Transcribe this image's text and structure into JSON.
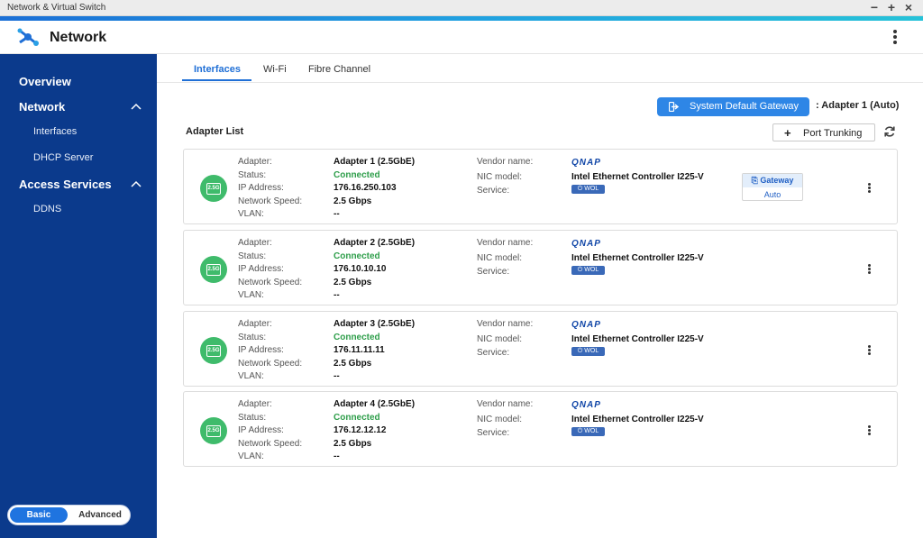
{
  "window": {
    "title": "Network & Virtual Switch",
    "controls": [
      "−",
      "+",
      "×"
    ]
  },
  "header": {
    "app_title": "Network"
  },
  "sidebar": {
    "items": [
      {
        "label": "Overview"
      },
      {
        "label": "Network"
      },
      {
        "label": "Interfaces"
      },
      {
        "label": "DHCP Server"
      },
      {
        "label": "Access Services"
      },
      {
        "label": "DDNS"
      }
    ],
    "mode": {
      "basic": "Basic",
      "advanced": "Advanced",
      "selected": "Basic"
    }
  },
  "tabs": [
    {
      "label": "Interfaces"
    },
    {
      "label": "Wi-Fi"
    },
    {
      "label": "Fibre Channel"
    }
  ],
  "gateway": {
    "button_label": "System Default Gateway",
    "value": ": Adapter 1 (Auto)"
  },
  "adapter_list": {
    "title": "Adapter List",
    "port_trunking_label": "Port Trunking",
    "field_labels": {
      "adapter": "Adapter:",
      "status": "Status:",
      "ip": "IP Address:",
      "speed": "Network Speed:",
      "vlan": "VLAN:",
      "vendor": "Vendor name:",
      "nic": "NIC model:",
      "service": "Service:"
    },
    "adapters": [
      {
        "icon_text": "2.5G",
        "name": "Adapter 1 (2.5GbE)",
        "status": "Connected",
        "ip": "176.16.250.103",
        "speed": "2.5 Gbps",
        "vlan": "--",
        "vendor": "QNAP",
        "nic": "Intel Ethernet Controller I225-V",
        "service": "WOL",
        "gateway": {
          "label": "Gateway",
          "mode": "Auto"
        }
      },
      {
        "icon_text": "2.5G",
        "name": "Adapter 2 (2.5GbE)",
        "status": "Connected",
        "ip": "176.10.10.10",
        "speed": "2.5 Gbps",
        "vlan": "--",
        "vendor": "QNAP",
        "nic": "Intel Ethernet Controller I225-V",
        "service": "WOL"
      },
      {
        "icon_text": "2.5G",
        "name": "Adapter 3 (2.5GbE)",
        "status": "Connected",
        "ip": "176.11.11.11",
        "speed": "2.5 Gbps",
        "vlan": "--",
        "vendor": "QNAP",
        "nic": "Intel Ethernet Controller I225-V",
        "service": "WOL"
      },
      {
        "icon_text": "2.5G",
        "name": "Adapter 4 (2.5GbE)",
        "status": "Connected",
        "ip": "176.12.12.12",
        "speed": "2.5 Gbps",
        "vlan": "--",
        "vendor": "QNAP",
        "nic": "Intel Ethernet Controller I225-V",
        "service": "WOL"
      }
    ]
  },
  "colors": {
    "sidebar": "#0b3a8c",
    "accent": "#1f6fd6",
    "connected": "#2e9e4a",
    "adapter_icon": "#3fbb6b"
  }
}
